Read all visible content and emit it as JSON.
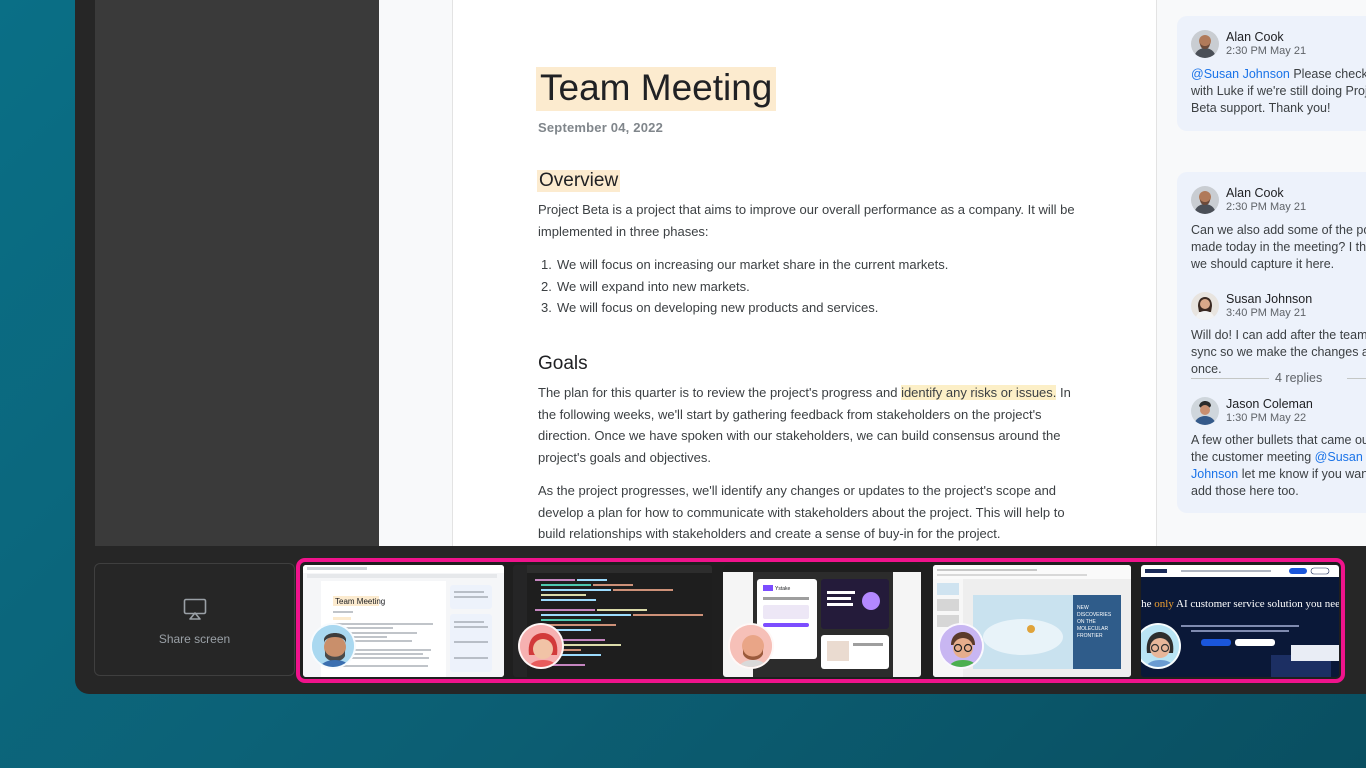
{
  "document": {
    "title": "Team Meeting",
    "date": "September 04, 2022",
    "overview": {
      "heading": "Overview",
      "intro": "Project Beta is a project that aims to improve our overall performance as a company. It will be implemented in three phases:",
      "items": [
        {
          "num": "1.",
          "text": "We will focus on increasing our market share in the current markets."
        },
        {
          "num": "2.",
          "text": "We will expand into new markets."
        },
        {
          "num": "3.",
          "text": "We will focus on developing new products and services."
        }
      ]
    },
    "goals": {
      "heading": "Goals",
      "p1_before": "The plan for this quarter is to review the project's progress and ",
      "p1_highlight": "identify any risks or issues.",
      "p1_after": " In the following weeks, we'll start by gathering feedback from stakeholders on the project's direction. Once we have spoken with our stakeholders, we can build consensus around the project's goals and objectives.",
      "p2": "As the project progresses, we'll identify any changes or updates to the project's scope and develop a plan for how to communicate with stakeholders about the project. This will help to build relationships with stakeholders and create a sense of buy-in for the project."
    }
  },
  "comments": {
    "card1": {
      "name": "Alan Cook",
      "time": "2:30 PM May 21",
      "mention": "@Susan Johnson",
      "text": " Please check with Luke if we're still doing Project Beta support. Thank you!"
    },
    "card2": {
      "c1": {
        "name": "Alan Cook",
        "time": "2:30 PM May 21",
        "text": "Can we also add some of the points made today in the meeting? I think we should capture it here."
      },
      "c2": {
        "name": "Susan Johnson",
        "time": "3:40 PM May 21",
        "text": "Will do! I can add after the team sync so we make the changes all at once."
      },
      "replies": "4 replies",
      "c3": {
        "name": "Jason Coleman",
        "time": "1:30 PM May 22",
        "text_before": "A few other bullets that came out of the customer meeting ",
        "mention": "@Susan Johnson",
        "text_after": " let me know if you want to add those here too."
      }
    }
  },
  "share": {
    "label": "Share screen",
    "icon": "cast-screen-icon"
  },
  "thumbnails": [
    {
      "name": "docs-window",
      "title": "Team Meeting"
    },
    {
      "name": "code-editor-window"
    },
    {
      "name": "design-tool-window",
      "title": "Ystake"
    },
    {
      "name": "slides-window",
      "title": "NEW DISCOVERIES ON THE MOLECULAR FRONTIER"
    },
    {
      "name": "website-window",
      "title": "The only AI customer service solution you need",
      "title_before": "The ",
      "title_em": "only",
      "title_after": " AI customer service solution you need"
    }
  ],
  "colors": {
    "accent": "#f0138c",
    "background": "#0b6a80",
    "highlight": "#fcebcf",
    "mention": "#1a73e8"
  }
}
